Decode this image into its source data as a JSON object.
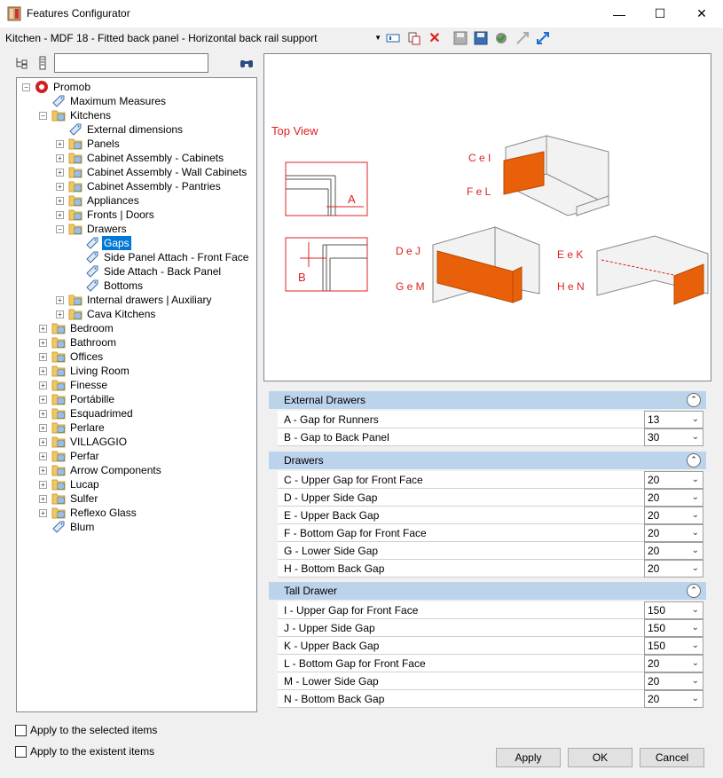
{
  "window": {
    "title": "Features Configurator",
    "minimize": "—",
    "maximize": "☐",
    "close": "✕"
  },
  "toolbar": {
    "config_value": "Kitchen - MDF 18 - Fitted back panel - Horizontal back rail support"
  },
  "search": {
    "placeholder": ""
  },
  "tree": [
    {
      "label": "Promob",
      "level": 0,
      "type": "root",
      "expander": "-"
    },
    {
      "label": "Maximum Measures",
      "level": 1,
      "type": "tag",
      "expander": ""
    },
    {
      "label": "Kitchens",
      "level": 1,
      "type": "folder",
      "expander": "-"
    },
    {
      "label": "External dimensions",
      "level": 2,
      "type": "tag",
      "expander": ""
    },
    {
      "label": "Panels",
      "level": 2,
      "type": "folder",
      "expander": "+"
    },
    {
      "label": "Cabinet Assembly - Cabinets",
      "level": 2,
      "type": "folder",
      "expander": "+"
    },
    {
      "label": "Cabinet Assembly - Wall Cabinets",
      "level": 2,
      "type": "folder",
      "expander": "+"
    },
    {
      "label": "Cabinet Assembly - Pantries",
      "level": 2,
      "type": "folder",
      "expander": "+"
    },
    {
      "label": "Appliances",
      "level": 2,
      "type": "folder",
      "expander": "+"
    },
    {
      "label": "Fronts | Doors",
      "level": 2,
      "type": "folder",
      "expander": "+"
    },
    {
      "label": "Drawers",
      "level": 2,
      "type": "folder",
      "expander": "-"
    },
    {
      "label": "Gaps",
      "level": 3,
      "type": "tag",
      "expander": "",
      "selected": true
    },
    {
      "label": "Side Panel Attach - Front Face",
      "level": 3,
      "type": "tag",
      "expander": ""
    },
    {
      "label": "Side Attach - Back Panel",
      "level": 3,
      "type": "tag",
      "expander": ""
    },
    {
      "label": "Bottoms",
      "level": 3,
      "type": "tag",
      "expander": ""
    },
    {
      "label": "Internal drawers | Auxiliary",
      "level": 2,
      "type": "folder",
      "expander": "+"
    },
    {
      "label": "Cava Kitchens",
      "level": 2,
      "type": "folder",
      "expander": "+"
    },
    {
      "label": "Bedroom",
      "level": 1,
      "type": "folder",
      "expander": "+"
    },
    {
      "label": "Bathroom",
      "level": 1,
      "type": "folder",
      "expander": "+"
    },
    {
      "label": "Offices",
      "level": 1,
      "type": "folder",
      "expander": "+"
    },
    {
      "label": "Living Room",
      "level": 1,
      "type": "folder",
      "expander": "+"
    },
    {
      "label": "Finesse",
      "level": 1,
      "type": "folder",
      "expander": "+"
    },
    {
      "label": "Portábille",
      "level": 1,
      "type": "folder",
      "expander": "+"
    },
    {
      "label": "Esquadrimed",
      "level": 1,
      "type": "folder",
      "expander": "+"
    },
    {
      "label": "Perlare",
      "level": 1,
      "type": "folder",
      "expander": "+"
    },
    {
      "label": "VILLAGGIO",
      "level": 1,
      "type": "folder",
      "expander": "+"
    },
    {
      "label": "Perfar",
      "level": 1,
      "type": "folder",
      "expander": "+"
    },
    {
      "label": "Arrow Components",
      "level": 1,
      "type": "folder",
      "expander": "+"
    },
    {
      "label": "Lucap",
      "level": 1,
      "type": "folder",
      "expander": "+"
    },
    {
      "label": "Sulfer",
      "level": 1,
      "type": "folder",
      "expander": "+"
    },
    {
      "label": "Reflexo Glass",
      "level": 1,
      "type": "folder",
      "expander": "+"
    },
    {
      "label": "Blum",
      "level": 1,
      "type": "tag",
      "expander": ""
    }
  ],
  "preview": {
    "top_view": "Top View",
    "labels": {
      "a": "A",
      "b": "B",
      "cel": "C e I",
      "fel": "F e L",
      "dej": "D e J",
      "gem": "G e M",
      "eek": "E e K",
      "hen": "H e N"
    }
  },
  "sections": [
    {
      "title": "External Drawers",
      "rows": [
        {
          "label": "A - Gap for Runners",
          "value": "13"
        },
        {
          "label": "B - Gap to Back Panel",
          "value": "30"
        }
      ]
    },
    {
      "title": "Drawers",
      "rows": [
        {
          "label": "C - Upper Gap for Front Face",
          "value": "20"
        },
        {
          "label": "D - Upper Side Gap",
          "value": "20"
        },
        {
          "label": "E - Upper Back Gap",
          "value": "20"
        },
        {
          "label": "F - Bottom Gap for Front Face",
          "value": "20"
        },
        {
          "label": "G - Lower Side Gap",
          "value": "20"
        },
        {
          "label": "H - Bottom Back Gap",
          "value": "20"
        }
      ]
    },
    {
      "title": "Tall Drawer",
      "rows": [
        {
          "label": "I - Upper Gap for Front Face",
          "value": "150"
        },
        {
          "label": "J - Upper Side Gap",
          "value": "150"
        },
        {
          "label": "K - Upper Back Gap",
          "value": "150"
        },
        {
          "label": "L - Bottom Gap for Front Face",
          "value": "20"
        },
        {
          "label": "M - Lower Side Gap",
          "value": "20"
        },
        {
          "label": "N - Bottom Back Gap",
          "value": "20"
        }
      ]
    }
  ],
  "options": {
    "apply_selected": "Apply to the selected items",
    "apply_existent": "Apply to the existent items"
  },
  "buttons": {
    "apply": "Apply",
    "ok": "OK",
    "cancel": "Cancel"
  },
  "colors": {
    "accent_red": "#e02020",
    "drawer_orange": "#e8600a",
    "section_blue": "#bcd3ec",
    "selection": "#0078d7"
  }
}
